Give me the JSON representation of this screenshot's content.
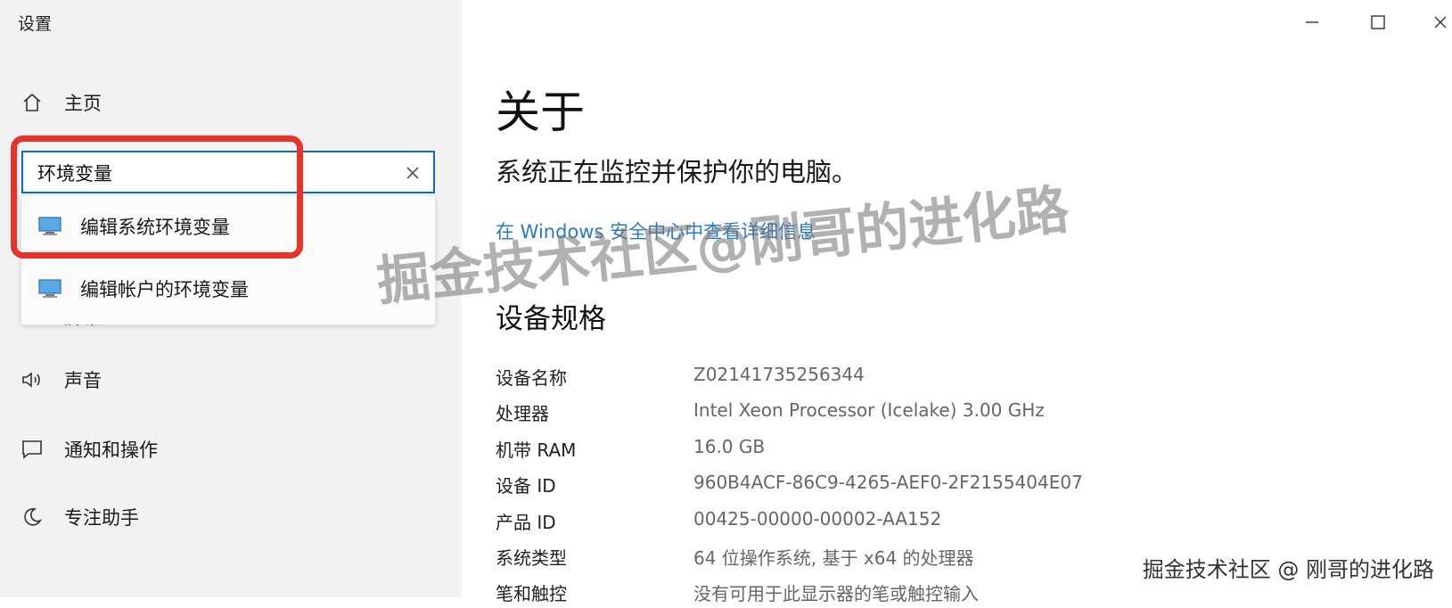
{
  "app": {
    "title": "设置"
  },
  "window_controls": {
    "minimize_glyph": "—",
    "maximize_glyph": "☐",
    "close_glyph": "✕"
  },
  "sidebar": {
    "home_label": "主页",
    "search": {
      "value": "环境变量",
      "clear_glyph": "✕"
    },
    "suggestions": [
      {
        "label": "编辑系统环境变量",
        "icon": "monitor-icon"
      },
      {
        "label": "编辑帐户的环境变量",
        "icon": "monitor-icon"
      }
    ],
    "items": [
      {
        "label": "屏幕",
        "icon": "display-icon"
      },
      {
        "label": "声音",
        "icon": "speaker-icon"
      },
      {
        "label": "通知和操作",
        "icon": "notification-icon"
      },
      {
        "label": "专注助手",
        "icon": "moon-icon"
      }
    ]
  },
  "main": {
    "title": "关于",
    "status_text": "系统正在监控并保护你的电脑。",
    "security_link": "在 Windows 安全中心中查看详细信息",
    "specs_title": "设备规格",
    "specs": [
      {
        "key": "设备名称",
        "value": "Z02141735256344"
      },
      {
        "key": "处理器",
        "value": "Intel Xeon Processor (Icelake)   3.00 GHz"
      },
      {
        "key": "机带 RAM",
        "value": "16.0 GB"
      },
      {
        "key": "设备 ID",
        "value": "960B4ACF-86C9-4265-AEF0-2F2155404E07"
      },
      {
        "key": "产品 ID",
        "value": "00425-00000-00002-AA152"
      },
      {
        "key": "系统类型",
        "value": "64 位操作系统, 基于 x64 的处理器"
      },
      {
        "key": "笔和触控",
        "value": "没有可用于此显示器的笔或触控输入"
      }
    ]
  },
  "watermark": {
    "large": "掘金技术社区@刚哥的进化路",
    "small": "掘金技术社区 @ 刚哥的进化路"
  },
  "colors": {
    "accent": "#0a6cc4",
    "link": "#2b78c5",
    "highlight": "#e8332a",
    "sidebar_bg": "#f2f2f2"
  }
}
